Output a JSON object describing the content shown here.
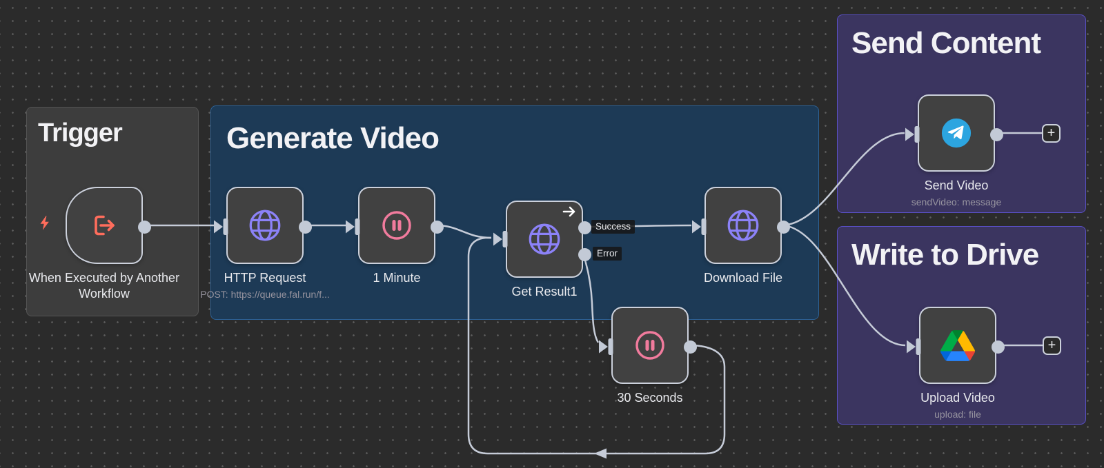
{
  "workflow": {
    "groups": {
      "trigger": {
        "title": "Trigger"
      },
      "generate_video": {
        "title": "Generate Video"
      },
      "send_content": {
        "title": "Send Content"
      },
      "write_to_drive": {
        "title": "Write to Drive"
      }
    },
    "nodes": {
      "when_executed": {
        "label": "When Executed by Another Workflow"
      },
      "http_request": {
        "label": "HTTP Request",
        "subtitle": "POST: https://queue.fal.run/f..."
      },
      "wait_1_minute": {
        "label": "1 Minute"
      },
      "get_result1": {
        "label": "Get Result1",
        "outputs": {
          "success": "Success",
          "error": "Error"
        }
      },
      "download_file": {
        "label": "Download File"
      },
      "wait_30_seconds": {
        "label": "30 Seconds"
      },
      "send_video": {
        "label": "Send Video",
        "subtitle": "sendVideo: message"
      },
      "upload_video": {
        "label": "Upload Video",
        "subtitle": "upload: file"
      }
    },
    "buttons": {
      "add_node": "+"
    },
    "colors": {
      "canvas_bg": "#2b2b2b",
      "group_trigger_bg": "#3d3d3d",
      "group_generate_bg": "#1d3a56",
      "group_purple_bg": "#3b3560",
      "group_purple_border": "#5a50c8",
      "node_bg": "#414141",
      "node_border": "#ccd1dc",
      "connection": "#c6ccd8",
      "globe_icon": "#8c82f8",
      "pause_icon": "#f17b9d",
      "trigger_icon": "#ff6d5c",
      "telegram_blue": "#2ca5e0",
      "drive_green": "#00ac47",
      "drive_yellow": "#ffba00",
      "drive_blue": "#2684fc",
      "drive_red": "#ea4335"
    }
  }
}
